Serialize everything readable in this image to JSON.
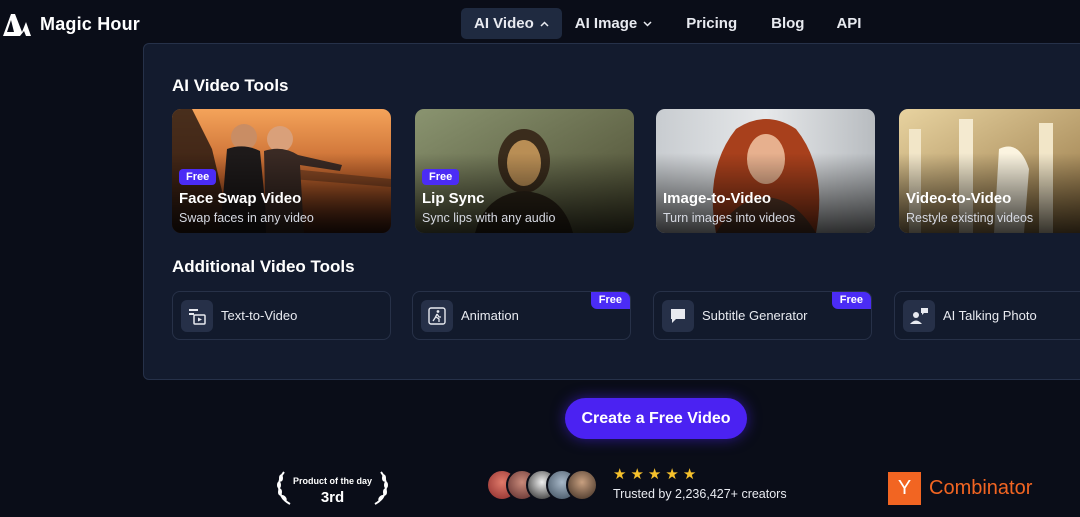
{
  "brand": {
    "name": "Magic Hour"
  },
  "nav": {
    "ai_video": "AI Video",
    "ai_image": "AI Image",
    "pricing": "Pricing",
    "blog": "Blog",
    "api": "API"
  },
  "dropdown": {
    "section_tools": "AI Video Tools",
    "section_additional": "Additional Video Tools",
    "cards": [
      {
        "title": "Face Swap Video",
        "desc": "Swap faces in any video",
        "badge": "Free"
      },
      {
        "title": "Lip Sync",
        "desc": "Sync lips with any audio",
        "badge": "Free"
      },
      {
        "title": "Image-to-Video",
        "desc": "Turn images into videos"
      },
      {
        "title": "Video-to-Video",
        "desc": "Restyle existing videos"
      }
    ],
    "tools": [
      {
        "label": "Text-to-Video",
        "icon": "play-text-icon"
      },
      {
        "label": "Animation",
        "icon": "running-figure-icon",
        "badge": "Free"
      },
      {
        "label": "Subtitle Generator",
        "icon": "chat-bubble-icon",
        "badge": "Free"
      },
      {
        "label": "AI Talking Photo",
        "icon": "talking-person-icon"
      }
    ]
  },
  "cta": {
    "label": "Create a Free Video"
  },
  "award": {
    "line1": "Product of the day",
    "line2": "3rd"
  },
  "social": {
    "rating_stars": 5,
    "trusted": "Trusted by 2,236,427+ creators"
  },
  "yc": {
    "letter": "Y",
    "text": "Combinator"
  },
  "colors": {
    "accent": "#4b22f2",
    "background": "#0a0d18",
    "panel": "#131b2e",
    "star": "#f6c12c",
    "yc": "#f26522"
  }
}
